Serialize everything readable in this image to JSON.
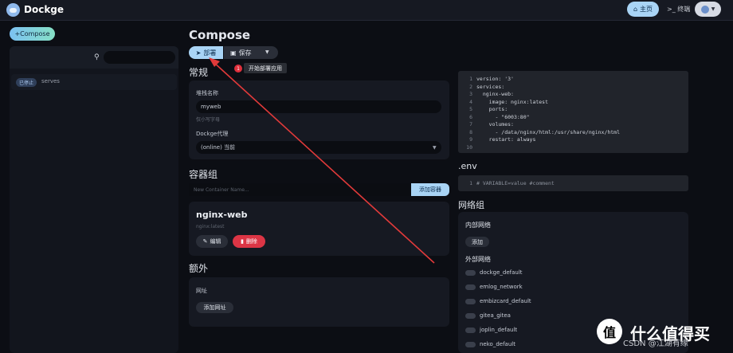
{
  "header": {
    "app_title": "Dockge",
    "home_label": "主页",
    "terminal_label": "终端"
  },
  "sidebar": {
    "compose_label": "Compose",
    "search_placeholder": "",
    "stacks": [
      {
        "status": "已停止",
        "name": "serves"
      }
    ]
  },
  "main": {
    "page_title": "Compose",
    "deploy_label": "部署",
    "save_label": "保存",
    "annotation": {
      "number": "1",
      "text": "开始部署应用"
    },
    "general": {
      "heading": "常规",
      "stack_name_label": "堆栈名称",
      "stack_name_value": "myweb",
      "stack_name_help": "仅小写字母",
      "agent_label": "Dockge代理",
      "agent_value": "(online) 当前"
    },
    "containers": {
      "heading": "容器组",
      "add_placeholder": "New Container Name...",
      "add_button": "添加容器",
      "service_name": "nginx-web",
      "service_image": "nginx:latest",
      "edit_label": "编辑",
      "delete_label": "删除"
    },
    "extra": {
      "heading": "额外",
      "url_label": "网址",
      "add_url_label": "添加网址"
    }
  },
  "editor": {
    "lines": [
      {
        "n": "1",
        "text": "version: '3'"
      },
      {
        "n": "2",
        "text": "services:"
      },
      {
        "n": "3",
        "text": "  nginx-web:"
      },
      {
        "n": "4",
        "text": "    image: nginx:latest"
      },
      {
        "n": "5",
        "text": "    ports:"
      },
      {
        "n": "6",
        "text": "      - \"6003:80\""
      },
      {
        "n": "7",
        "text": "    volumes:"
      },
      {
        "n": "8",
        "text": "      - /data/nginx/html:/usr/share/nginx/html"
      },
      {
        "n": "9",
        "text": "    restart: always"
      },
      {
        "n": "10",
        "text": ""
      }
    ]
  },
  "env": {
    "title": ".env",
    "line_number": "1",
    "line_text": "# VARIABLE=value #comment"
  },
  "networks": {
    "heading": "网络组",
    "internal_label": "内部网络",
    "add_label": "添加",
    "external_label": "外部网络",
    "external": [
      "dockge_default",
      "emlog_network",
      "embizcard_default",
      "gitea_gitea",
      "joplin_default",
      "neko_default"
    ]
  },
  "watermark": {
    "icon_text": "值",
    "text": "什么值得买",
    "sub": "CSDN @江湖有缘"
  }
}
